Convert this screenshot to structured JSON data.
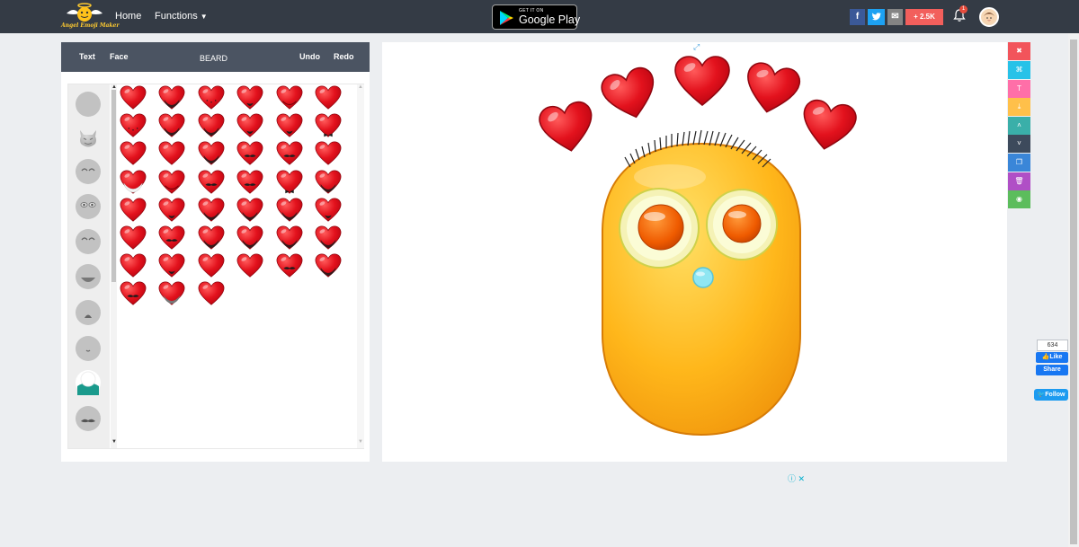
{
  "nav": {
    "logo_text": "Angel Emoji Maker",
    "home": "Home",
    "functions": "Functions",
    "google_play_top": "GET IT ON",
    "google_play_main": "Google Play",
    "share_count": "+ 2.5K",
    "notification_count": "1",
    "social_icons": [
      "facebook-icon",
      "twitter-icon",
      "email-icon"
    ]
  },
  "editor": {
    "tabs": {
      "text": "Text",
      "face": "Face",
      "current": "BEARD",
      "undo": "Undo",
      "redo": "Redo"
    },
    "face_options": [
      "blank",
      "devil",
      "closed-eyes",
      "eyes",
      "closed-eyes-2",
      "open-mouth",
      "frown",
      "small-mouth",
      "mustache-white",
      "mustache"
    ],
    "beard_grid_rows": [
      [
        "plain",
        "black-beard",
        "dots",
        "goatee",
        "red",
        "plain"
      ],
      [
        "dots",
        "black-chin",
        "full-beard",
        "chin-beard",
        "goatee",
        "bow"
      ],
      [
        "plain",
        "plain",
        "boxed",
        "mustache",
        "mustache",
        "plain"
      ],
      [
        "white",
        "red-beard",
        "red-mustache",
        "mustache",
        "tie",
        "black-mustache"
      ],
      [
        "plain",
        "goatee",
        "beard",
        "black",
        "beard",
        "goatee"
      ],
      [
        "plain",
        "mustache",
        "beard",
        "black",
        "beard",
        "beard"
      ],
      [
        "plain",
        "chin",
        "plain",
        "plain",
        "mustache",
        "beard"
      ],
      [
        "mustache",
        "grey-beard",
        "plain"
      ]
    ]
  },
  "toolbar": {
    "tools": [
      {
        "icon": "close-icon",
        "glyph": "✖",
        "color": "#f2545b"
      },
      {
        "icon": "random-icon",
        "glyph": "⌘",
        "color": "#27c2e8"
      },
      {
        "icon": "text-icon",
        "glyph": "T",
        "color": "#ff6fa8"
      },
      {
        "icon": "download-icon",
        "glyph": "⤓",
        "color": "#ffc04a"
      },
      {
        "icon": "chevron-up-icon",
        "glyph": "˄",
        "color": "#3aafa9"
      },
      {
        "icon": "chevron-down-icon",
        "glyph": "˅",
        "color": "#3d4a5c"
      },
      {
        "icon": "copy-icon",
        "glyph": "❐",
        "color": "#3a86d8"
      },
      {
        "icon": "trash-icon",
        "glyph": "🗑",
        "color": "#b04fc6"
      },
      {
        "icon": "hide-icon",
        "glyph": "◉",
        "color": "#5cbd5c"
      }
    ]
  },
  "social": {
    "like_count": "634",
    "like": "Like",
    "share": "Share",
    "follow": "Follow"
  },
  "colors": {
    "navbar": "#343b45",
    "tabbar": "#4b5462",
    "heart": "#e3121d",
    "face": "#ffb71b"
  }
}
